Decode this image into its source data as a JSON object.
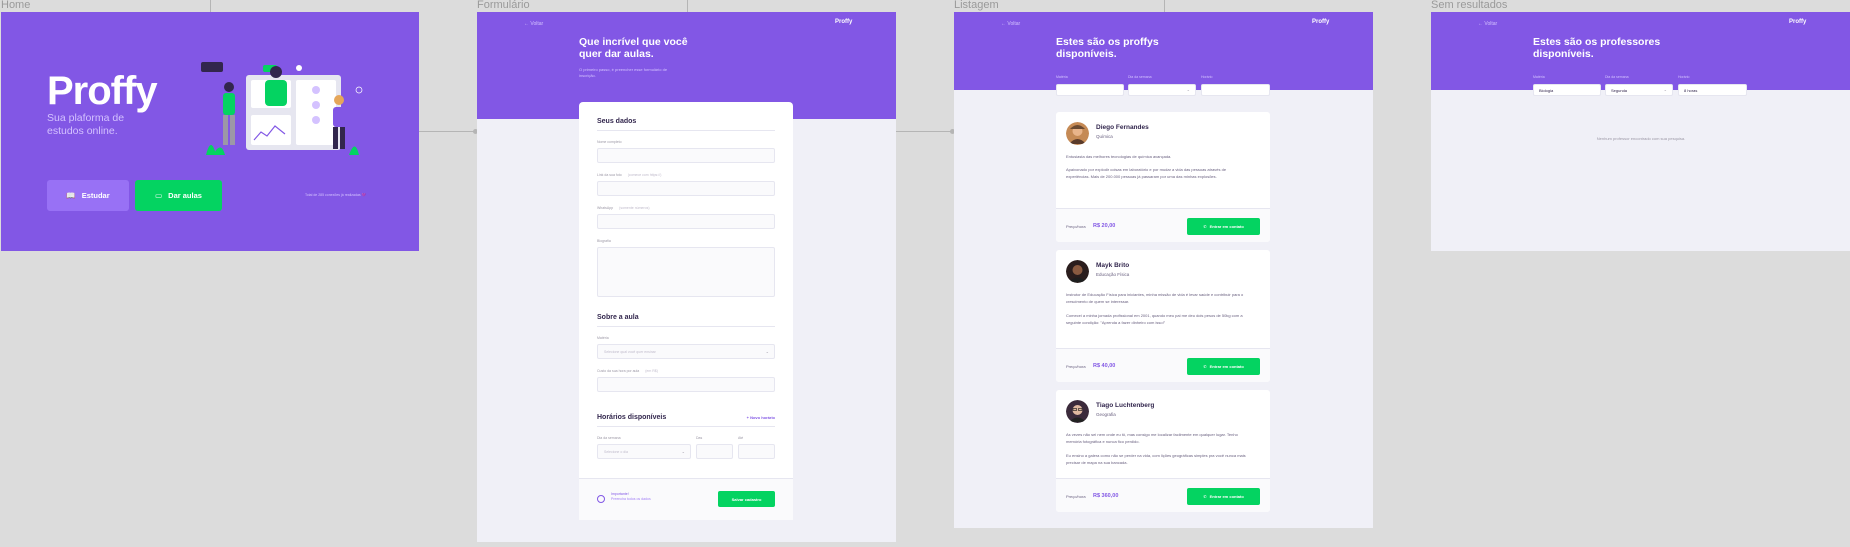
{
  "frames": {
    "home": "Home",
    "form": "Formulário",
    "list": "Listagem",
    "empty": "Sem resultados"
  },
  "home": {
    "logo": "Proffy",
    "tagline": "Sua plaforma de estudos online.",
    "study_button": "Estudar",
    "teach_button": "Dar aulas",
    "connections_text": "Total de 285 conexões já realizadas 💜"
  },
  "common": {
    "back": "← Voltar",
    "logo_small": "Proffy"
  },
  "form": {
    "title": "Que incrível que você quer dar aulas.",
    "subtitle": "O primeiro passo, é preencher esse formulário de inscrição.",
    "section_personal": "Seus dados",
    "label_name": "Nome completo",
    "label_avatar": "Link da sua foto",
    "note_avatar": "(comece com https://)",
    "label_whatsapp": "WhatsApp",
    "note_whatsapp": "(somente números)",
    "label_bio": "Biografia",
    "section_class": "Sobre a aula",
    "label_subject": "Matéria",
    "placeholder_subject": "Selecione qual você quer ensinar",
    "label_cost": "Custo da sua hora por aula",
    "note_cost": "(em R$)",
    "section_schedule": "Horários disponíveis",
    "new_time": "+ Novo horário",
    "label_weekday": "Dia da semana",
    "placeholder_weekday": "Selecione o dia",
    "label_from": "Das",
    "label_to": "Até",
    "warning_title": "Importante!",
    "warning_text": "Preencha todos os dados",
    "save_button": "Salvar cadastro"
  },
  "list": {
    "title": "Estes são os proffys disponíveis.",
    "filter_subject": "Matéria",
    "filter_weekday": "Dia da semana",
    "filter_time": "Horário",
    "price_label": "Preço/hora",
    "contact_button": "Entrar em contato",
    "teachers": [
      {
        "name": "Diego Fernandes",
        "subject": "Química",
        "bio1": "Entusiasta das melhores tecnologias de química avançada.",
        "bio2": "Apaixonado por explodir coisas em laboratório e por mudar a vida das pessoas através de experiências. Mais de 200.000 pessoas já passaram por uma das minhas explosões.",
        "price": "R$ 20,00"
      },
      {
        "name": "Mayk Brito",
        "subject": "Educação Física",
        "bio1": "Instrutor de Educação Física para iniciantes, minha missão de vida é levar saúde e contribuir para o crescimento de quem se interessar.",
        "bio2": "Comecei a minha jornada profissional em 2001, quando meu pai me deu dois pesos de 50kg com a seguinte condição: \"Aprenda a fazer dinheiro com isso!\"",
        "price": "R$ 40,00"
      },
      {
        "name": "Tiago Luchtenberg",
        "subject": "Geografia",
        "bio1": "As vezes não sei nem onde eu tô, mas consigo me localizar facilmente em qualquer lugar. Tenho memória fotográfica e nunca fico perdido.",
        "bio2": "Eu ensino a galera como não se perder na vida, com lições geográficas simples pra você nunca mais precisar de mapa na sua bancada.",
        "price": "R$ 360,00"
      }
    ]
  },
  "empty": {
    "title": "Estes são os professores disponíveis.",
    "filter_subject": "Matéria",
    "filter_weekday": "Dia da semana",
    "filter_time": "Horário",
    "value_subject": "Biologia",
    "value_weekday": "Segunda",
    "value_time": "8 horas",
    "message": "Nenhum professor encontrado com sua pesquisa."
  },
  "colors": {
    "primary": "#8257e5",
    "secondary": "#04d361",
    "background": "#f0f0f7"
  }
}
